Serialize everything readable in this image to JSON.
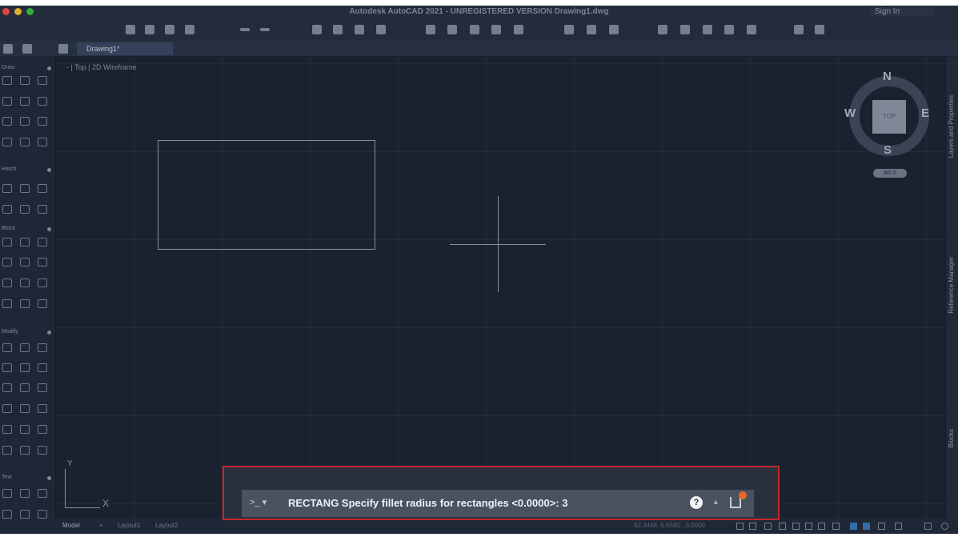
{
  "window": {
    "title": "Autodesk AutoCAD 2021 - UNREGISTERED VERSION   Drawing1.dwg",
    "sign_in": "Sign In"
  },
  "tabs": {
    "document": "Drawing1*"
  },
  "viewport": {
    "label": "- | Top | 2D Wireframe"
  },
  "palette": {
    "sections": [
      "Draw",
      "Hatch",
      "Block",
      "Modify",
      "Text"
    ]
  },
  "viewcube": {
    "north": "N",
    "south": "S",
    "east": "E",
    "west": "W",
    "face": "TOP",
    "wcs": "WCS"
  },
  "ucs": {
    "x": "X",
    "y": "Y"
  },
  "right_panel": [
    "Layers and Properties",
    "Reference Manager",
    "Blocks"
  ],
  "layout_tabs": [
    "Model",
    "+",
    "Layout1",
    "Layout2"
  ],
  "status": {
    "coordinates": "62.4448, 6.6580 , 0.0000"
  },
  "command": {
    "prompt": ">_ ▾",
    "text": "RECTANG Specify fillet radius for rectangles <0.0000>: 3",
    "help": "?",
    "up": "▲"
  },
  "colors": {
    "highlight": "#c4262e",
    "badge": "#e86a2a"
  }
}
